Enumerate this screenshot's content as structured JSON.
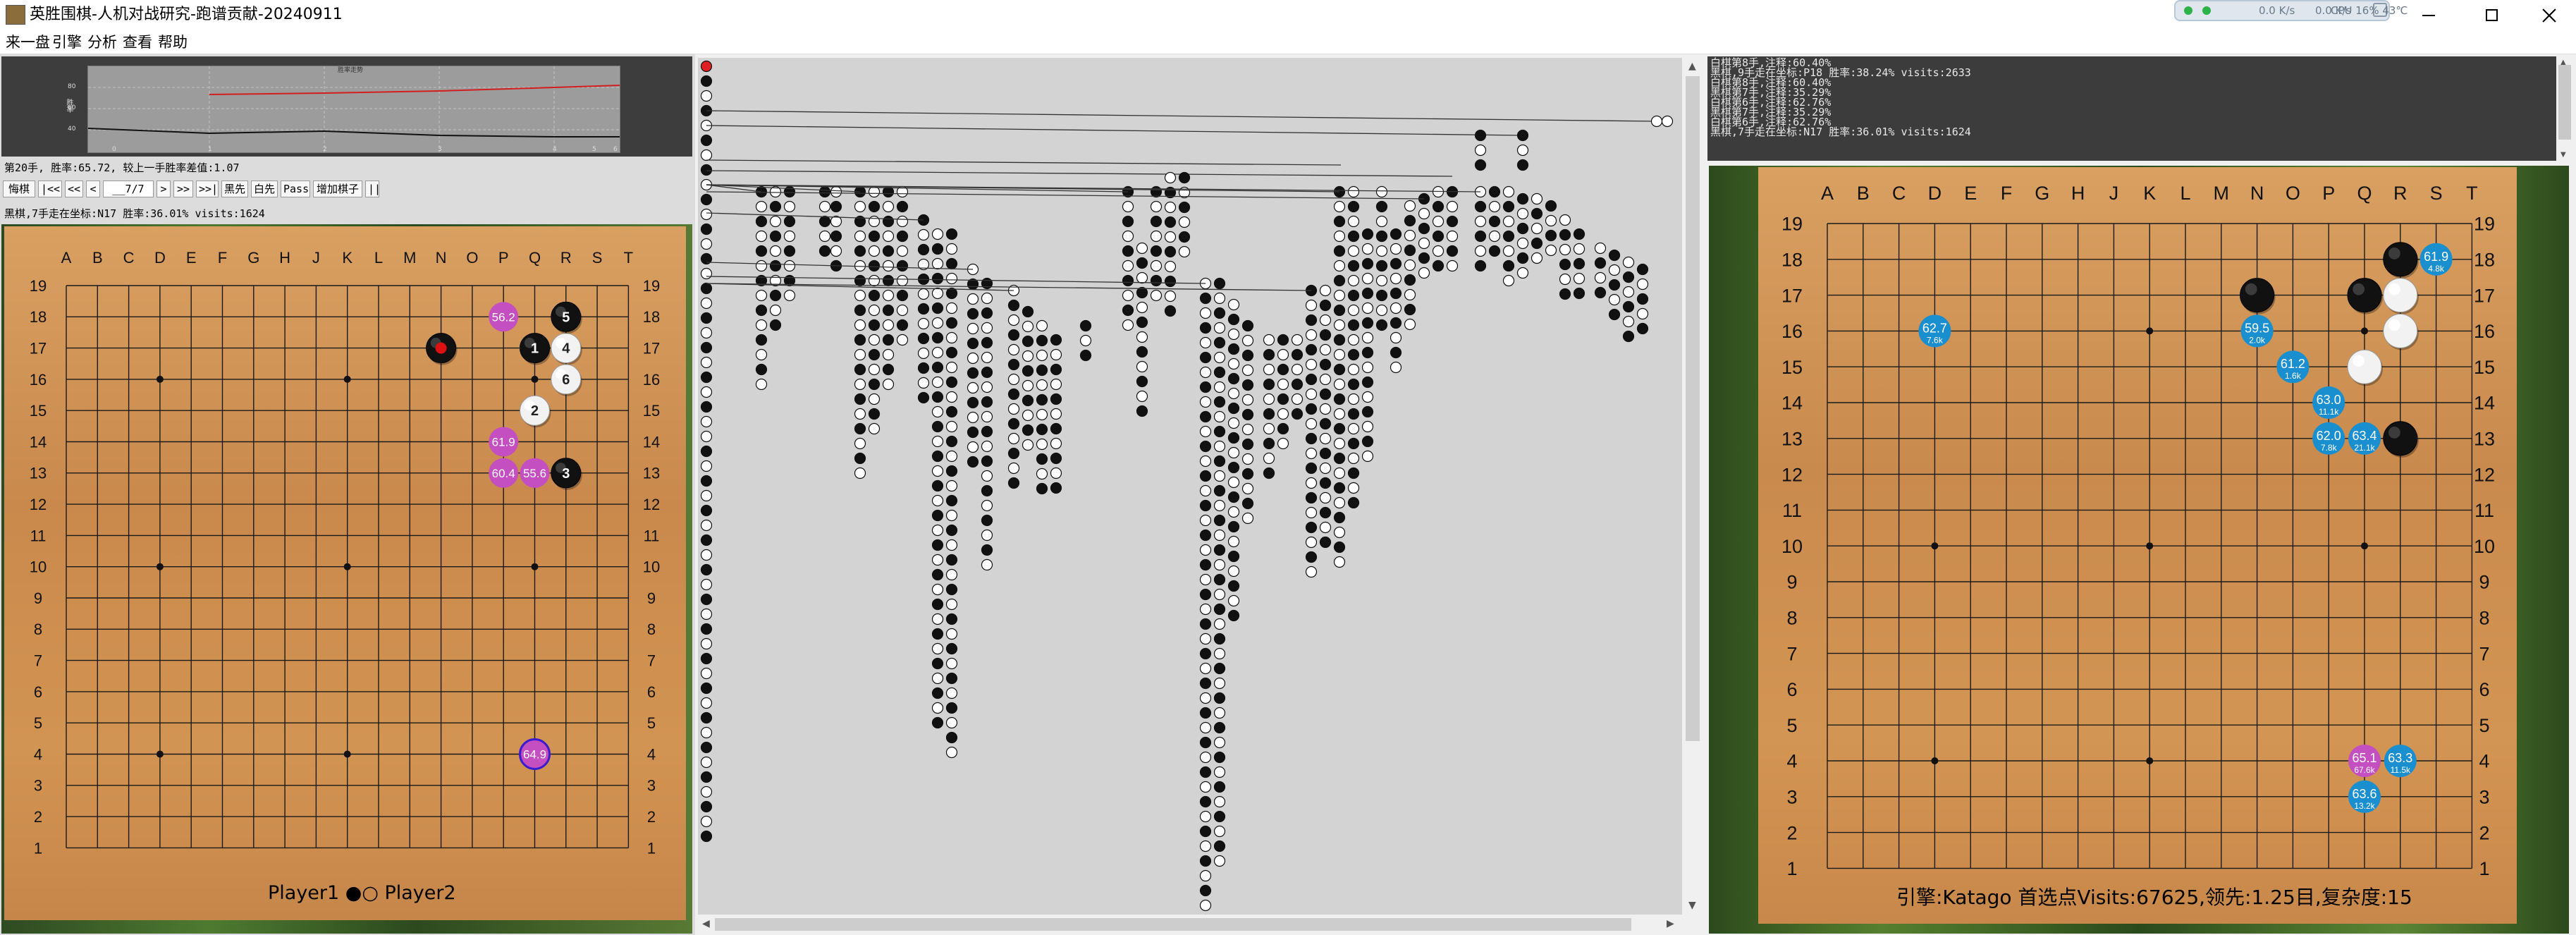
{
  "window": {
    "title": "英胜围棋-人机对战研究-跑谱贡献-20240911",
    "controls": {
      "minimize": "—",
      "maximize": "☐",
      "close": "✕"
    }
  },
  "tray": {
    "net_down": "0.0 K/s",
    "net_up": "0.0 K/s",
    "cpu": "CPU 16% 43℃"
  },
  "menu": [
    "来一盘",
    "引擎",
    "分析",
    "查看",
    "帮助"
  ],
  "winrate": {
    "title": "胜率走势",
    "y_ticks": [
      "80",
      "60",
      "40"
    ],
    "y_label": "胜率",
    "x_ticks": [
      "0",
      "1",
      "2",
      "3",
      "4",
      "5",
      "6"
    ]
  },
  "move_info": "第20手, 胜率:65.72, 较上一手胜率差值:1.07",
  "nav": {
    "buttons": [
      "悔棋",
      "|<<",
      "<<",
      "<",
      "__7/7",
      ">",
      ">>",
      ">>|",
      "黑先",
      "白先",
      "Pass",
      "增加棋子",
      "||"
    ]
  },
  "last_move_info": "黑棋,7手走在坐标:N17 胜率:36.01% visits:1624",
  "board_left": {
    "columns": [
      "A",
      "B",
      "C",
      "D",
      "E",
      "F",
      "G",
      "H",
      "J",
      "K",
      "L",
      "M",
      "N",
      "O",
      "P",
      "Q",
      "R",
      "S",
      "T"
    ],
    "rows": [
      "19",
      "18",
      "17",
      "16",
      "15",
      "14",
      "13",
      "12",
      "11",
      "10",
      "9",
      "8",
      "7",
      "6",
      "5",
      "4",
      "3",
      "2",
      "1"
    ],
    "star_points": [
      [
        4,
        4
      ],
      [
        4,
        10
      ],
      [
        4,
        16
      ],
      [
        10,
        4
      ],
      [
        10,
        10
      ],
      [
        10,
        16
      ],
      [
        16,
        4
      ],
      [
        16,
        10
      ],
      [
        16,
        16
      ]
    ],
    "stones": [
      {
        "col": 13,
        "row": 17,
        "color": "black",
        "label": "",
        "last": true
      },
      {
        "col": 16,
        "row": 17,
        "color": "black",
        "label": "1"
      },
      {
        "col": 16,
        "row": 15,
        "color": "white",
        "label": "2"
      },
      {
        "col": 17,
        "row": 13,
        "color": "black",
        "label": "3"
      },
      {
        "col": 17,
        "row": 17,
        "color": "white",
        "label": "4"
      },
      {
        "col": 17,
        "row": 18,
        "color": "black",
        "label": "5"
      },
      {
        "col": 17,
        "row": 16,
        "color": "white",
        "label": "6"
      }
    ],
    "candidates": [
      {
        "col": 15,
        "row": 18,
        "value": "56.2",
        "color": "#c44fc0"
      },
      {
        "col": 15,
        "row": 14,
        "value": "61.9",
        "color": "#c44fc0"
      },
      {
        "col": 15,
        "row": 13,
        "value": "60.4",
        "color": "#c44fc0"
      },
      {
        "col": 16,
        "row": 13,
        "value": "55.6",
        "color": "#c44fc0"
      },
      {
        "col": 16,
        "row": 4,
        "value": "64.9",
        "color": "#c44fc0",
        "best": true
      }
    ],
    "players": "Player1 ●○ Player2"
  },
  "log_lines": [
    "白棋第8手,注释:60.40%",
    "黑棋,9手走在坐标:P18 胜率:38.24% visits:2633",
    "白棋第8手,注释:60.40%",
    "黑棋第7手,注释:35.29%",
    "白棋第6手,注释:62.76%",
    "黑棋第7手,注释:35.29%",
    "白棋第6手,注释:62.76%",
    "黑棋,7手走在坐标:N17 胜率:36.01% visits:1624"
  ],
  "board_right": {
    "stones": [
      {
        "col": 17,
        "row": 18,
        "color": "black"
      },
      {
        "col": 13,
        "row": 17,
        "color": "black"
      },
      {
        "col": 16,
        "row": 17,
        "color": "black"
      },
      {
        "col": 17,
        "row": 17,
        "color": "white"
      },
      {
        "col": 17,
        "row": 16,
        "color": "white"
      },
      {
        "col": 16,
        "row": 15,
        "color": "white"
      },
      {
        "col": 17,
        "row": 13,
        "color": "black"
      }
    ],
    "candidates": [
      {
        "col": 18,
        "row": 18,
        "value": "61.9",
        "visits": "4.8k",
        "color": "#1a8fcf"
      },
      {
        "col": 4,
        "row": 16,
        "value": "62.7",
        "visits": "7.6k",
        "color": "#1a8fcf"
      },
      {
        "col": 13,
        "row": 16,
        "value": "59.5",
        "visits": "2.0k",
        "color": "#1a8fcf"
      },
      {
        "col": 14,
        "row": 15,
        "value": "61.2",
        "visits": "1.6k",
        "color": "#1a8fcf"
      },
      {
        "col": 15,
        "row": 14,
        "value": "63.0",
        "visits": "11.1k",
        "color": "#1a8fcf"
      },
      {
        "col": 15,
        "row": 13,
        "value": "62.0",
        "visits": "7.8k",
        "color": "#1a8fcf"
      },
      {
        "col": 16,
        "row": 13,
        "value": "63.4",
        "visits": "21.1k",
        "color": "#1a8fcf"
      },
      {
        "col": 16,
        "row": 4,
        "value": "65.1",
        "visits": "67.6k",
        "color": "#c44fc0"
      },
      {
        "col": 17,
        "row": 4,
        "value": "63.3",
        "visits": "11.5k",
        "color": "#1a8fcf"
      },
      {
        "col": 16,
        "row": 3,
        "value": "63.6",
        "visits": "13.2k",
        "color": "#1a8fcf"
      }
    ],
    "status": "引擎:Katago 首选点Visits:67625,领先:1.25目,复杂度:15"
  },
  "colors": {
    "board": "#d29452",
    "black_stone": "#111111",
    "white_stone": "#f2f2f2",
    "panel_dark": "#3c3c3c",
    "candidate_pink": "#c44fc0",
    "candidate_blue": "#1a8fcf"
  }
}
